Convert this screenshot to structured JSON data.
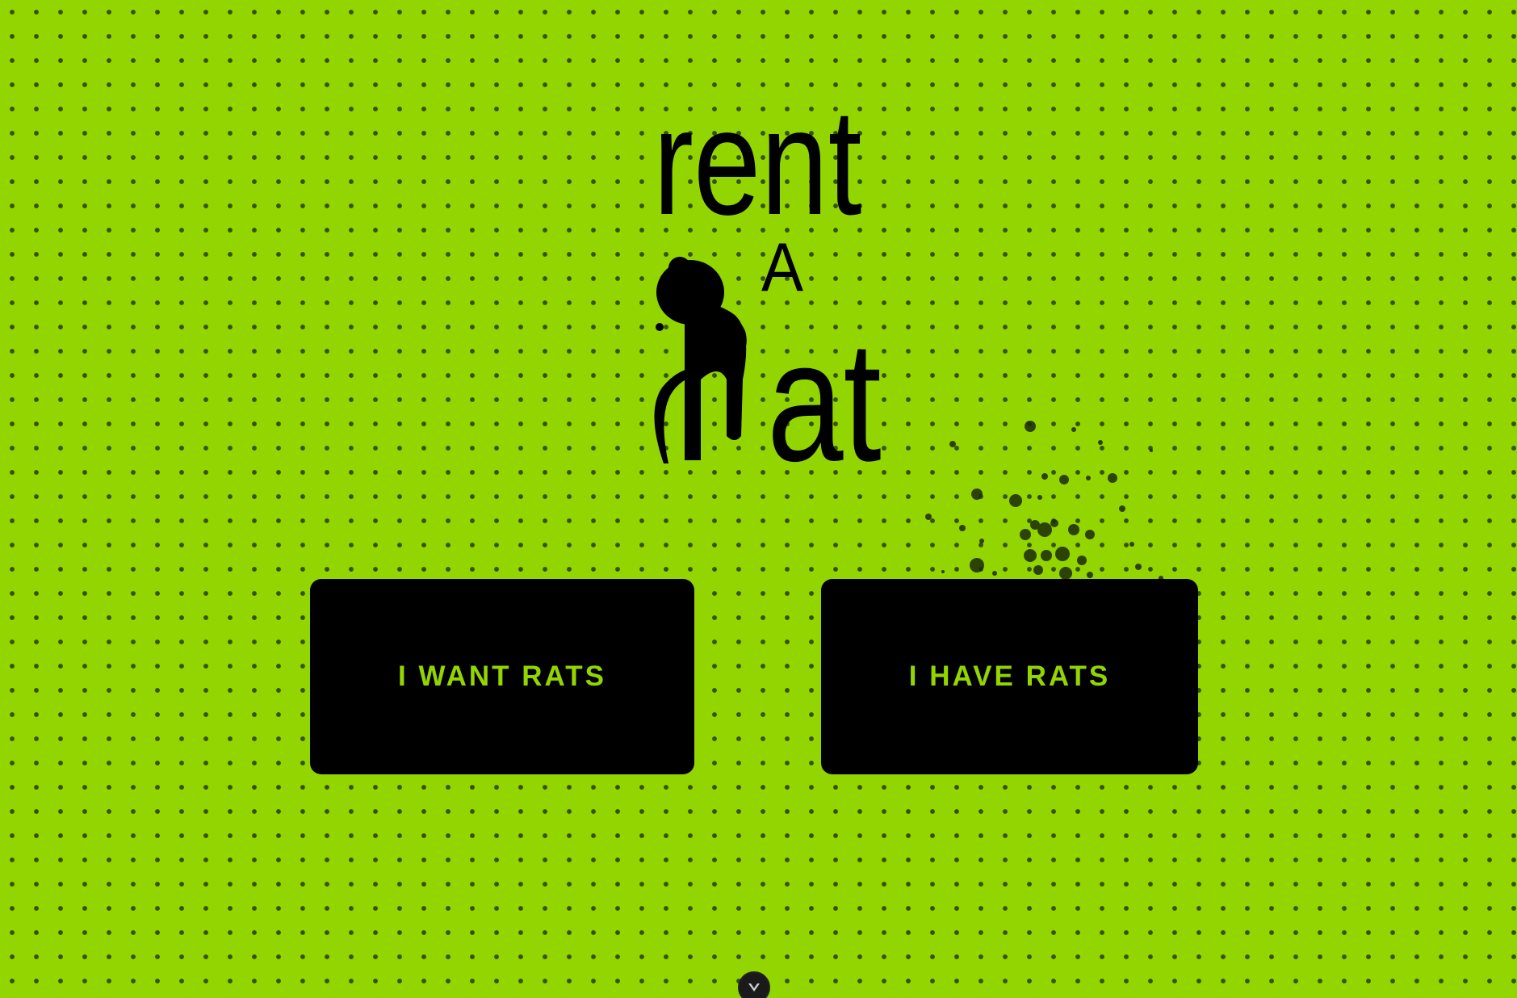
{
  "logo": {
    "line1": "rent",
    "line2": "A",
    "line3": "at"
  },
  "buttons": {
    "want_label": "I WANT RATS",
    "have_label": "I HAVE RATS"
  },
  "colors": {
    "background": "#93d500",
    "button_bg": "#000000",
    "button_text": "#93d500"
  },
  "icons": {
    "scroll": "chevron-down-icon",
    "mascot": "rat-silhouette-icon"
  }
}
